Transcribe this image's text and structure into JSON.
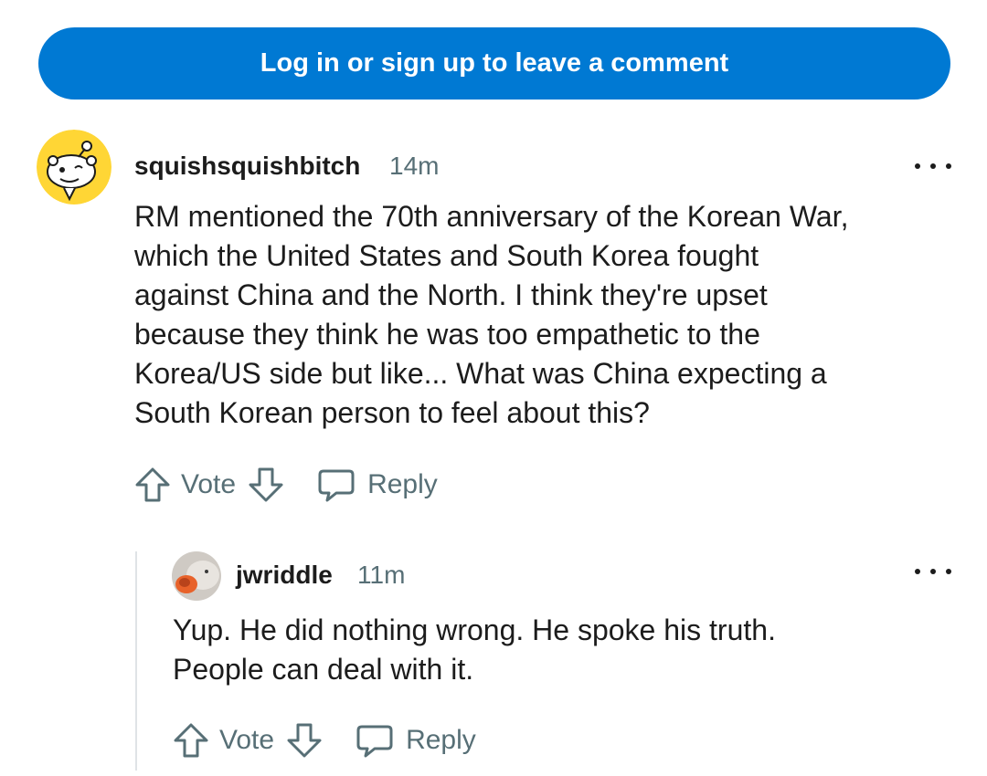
{
  "login_banner": {
    "label": "Log in or sign up to leave a comment"
  },
  "comments": [
    {
      "username": "squishsquishbitch",
      "time": "14m",
      "lines": [
        "RM mentioned the 70th anniversary of the Korean War,",
        "which the United States and South Korea fought",
        "against China and the North. I think they're upset",
        "because they think he was too empathetic to the",
        "Korea/US side but like... What was China expecting a",
        "South Korean person to feel about this?"
      ],
      "vote_label": "Vote",
      "reply_label": "Reply",
      "avatar_icon": "snoo-avatar-icon"
    },
    {
      "username": "jwriddle",
      "time": "11m",
      "lines": [
        "Yup. He did nothing wrong. He spoke his truth.",
        "People can deal with it."
      ],
      "vote_label": "Vote",
      "reply_label": "Reply",
      "avatar_icon": "photo-avatar"
    }
  ],
  "colors": {
    "accent": "#0079d3",
    "meta_text": "#576f76",
    "body_text": "#1c1c1c",
    "thread_line": "#dfe3e6",
    "snoo_yellow": "#ffd635"
  }
}
